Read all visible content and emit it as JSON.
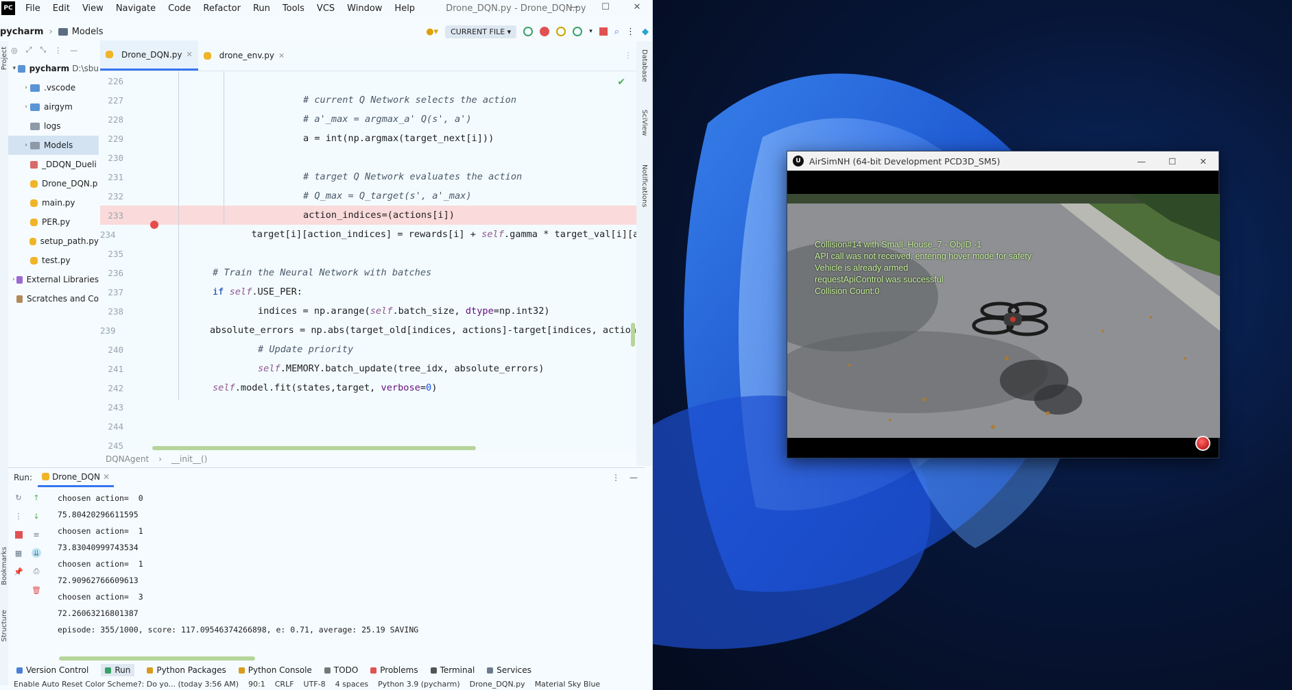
{
  "ide": {
    "logo": "PC",
    "menu": [
      "File",
      "Edit",
      "View",
      "Navigate",
      "Code",
      "Refactor",
      "Run",
      "Tools",
      "VCS",
      "Window",
      "Help"
    ],
    "window_title": "Drone_DQN.py - Drone_DQN.py",
    "nav": {
      "project": "pycharm",
      "folder": "Models",
      "run_config": "CURRENT FILE"
    },
    "left_stripe": {
      "project_label": "Project",
      "bookmarks_label": "Bookmarks",
      "structure_label": "Structure"
    },
    "right_stripe": {
      "database_label": "Database",
      "sciview_label": "SciView",
      "notifications_label": "Notifications"
    },
    "project_tree": [
      {
        "label": "pycharm",
        "suffix": "D:\\sbu",
        "type": "folder",
        "arrow": "▾",
        "indent": 0,
        "bold": true
      },
      {
        "label": ".vscode",
        "type": "folder",
        "arrow": "›",
        "indent": 1
      },
      {
        "label": "airgym",
        "type": "folder",
        "arrow": "›",
        "indent": 1
      },
      {
        "label": "logs",
        "type": "folder-gray",
        "arrow": "",
        "indent": 1
      },
      {
        "label": "Models",
        "type": "folder-gray",
        "arrow": "›",
        "indent": 1,
        "selected": true
      },
      {
        "label": "_DDQN_Dueli",
        "type": "image",
        "arrow": "",
        "indent": 1
      },
      {
        "label": "Drone_DQN.p",
        "type": "py",
        "arrow": "",
        "indent": 1
      },
      {
        "label": "main.py",
        "type": "py",
        "arrow": "",
        "indent": 1
      },
      {
        "label": "PER.py",
        "type": "py",
        "arrow": "",
        "indent": 1
      },
      {
        "label": "setup_path.py",
        "type": "py",
        "arrow": "",
        "indent": 1
      },
      {
        "label": "test.py",
        "type": "py",
        "arrow": "",
        "indent": 1
      },
      {
        "label": "External Libraries",
        "type": "lib",
        "arrow": "›",
        "indent": 0
      },
      {
        "label": "Scratches and Co",
        "type": "scratch",
        "arrow": "",
        "indent": 0
      }
    ],
    "tabs": [
      {
        "label": "Drone_DQN.py",
        "active": true
      },
      {
        "label": "drone_env.py",
        "active": false
      }
    ],
    "code_lines": [
      {
        "num": "226",
        "indent": 3,
        "html": ""
      },
      {
        "num": "227",
        "indent": 3,
        "html": "<span class=\"cm\"># current Q Network selects the action</span>"
      },
      {
        "num": "228",
        "indent": 3,
        "html": "<span class=\"cm\"># a'_max = argmax_a' Q(s', a')</span>"
      },
      {
        "num": "229",
        "indent": 3,
        "html": "a = int(np.argmax(target_next[i]))"
      },
      {
        "num": "230",
        "indent": 3,
        "html": ""
      },
      {
        "num": "231",
        "indent": 3,
        "html": "<span class=\"cm\"># target Q Network evaluates the action</span>"
      },
      {
        "num": "232",
        "indent": 3,
        "html": "<span class=\"cm\"># Q_max = Q_target(s', a'_max)</span>"
      },
      {
        "num": "233",
        "indent": 3,
        "html": "action_indices=(actions[i])",
        "breakpoint": true
      },
      {
        "num": "234",
        "indent": 3,
        "html": "target[i][action_indices] = rewards[i] + <span class=\"slf\">self</span>.gamma * target_val[i][a]"
      },
      {
        "num": "235",
        "indent": 2,
        "html": ""
      },
      {
        "num": "236",
        "indent": 1,
        "html": "<span class=\"cm\"># Train the Neural Network with batches</span>"
      },
      {
        "num": "237",
        "indent": 1,
        "html": "<span class=\"kw\">if</span> <span class=\"slf\">self</span>.USE_PER:"
      },
      {
        "num": "238",
        "indent": 2,
        "html": "indices = np.arange(<span class=\"slf\">self</span>.batch_size, <span class=\"prm\">dtype</span>=np.int32)"
      },
      {
        "num": "239",
        "indent": 2,
        "html": "absolute_errors = np.abs(target_old[indices, actions]-target[indices, action"
      },
      {
        "num": "240",
        "indent": 2,
        "html": "<span class=\"cm\"># Update priority</span>"
      },
      {
        "num": "241",
        "indent": 2,
        "html": "<span class=\"slf\">self</span>.MEMORY.batch_update(tree_idx, absolute_errors)"
      },
      {
        "num": "242",
        "indent": 1,
        "html": "<span class=\"slf\">self</span>.model.fit(states,target, <span class=\"prm\">verbose</span>=<span class=\"nm\">0</span>)"
      },
      {
        "num": "243",
        "indent": 0,
        "html": ""
      },
      {
        "num": "244",
        "indent": 0,
        "html": ""
      },
      {
        "num": "245",
        "indent": 0,
        "html": ""
      }
    ],
    "breadcrumbs": [
      "DQNAgent",
      "__init__()"
    ],
    "run": {
      "label": "Run:",
      "tab": "Drone_DQN",
      "output": [
        "choosen action=  0",
        "75.80420296611595",
        "choosen action=  1",
        "73.83040999743534",
        "choosen action=  1",
        "72.90962766609613",
        "choosen action=  3",
        "72.26063216801387",
        "episode: 355/1000, score: 117.09546374266898, e: 0.71, average: 25.19 SAVING"
      ]
    },
    "bottom_tabs": [
      "Version Control",
      "Run",
      "Python Packages",
      "Python Console",
      "TODO",
      "Problems",
      "Terminal",
      "Services"
    ],
    "status": [
      "Enable Auto Reset Color Scheme?: Do yo... (today 3:56 AM)",
      "90:1",
      "CRLF",
      "UTF-8",
      "4 spaces",
      "Python 3.9 (pycharm)",
      "Drone_DQN.py",
      "Material Sky Blue"
    ]
  },
  "airsim": {
    "title": "AirSimNH (64-bit Development PCD3D_SM5)",
    "logo": "U",
    "hud": [
      "Collision#14 with Small_House_7 - ObjID -1",
      "API call was not received, entering hover mode for safety",
      "Vehicle is already armed",
      "requestApiControl was successful",
      "Collision Count:0"
    ]
  },
  "colors": {
    "accent": "#3574f0",
    "breakpoint": "#e74c4c",
    "hud_text": "#c9f59d"
  }
}
